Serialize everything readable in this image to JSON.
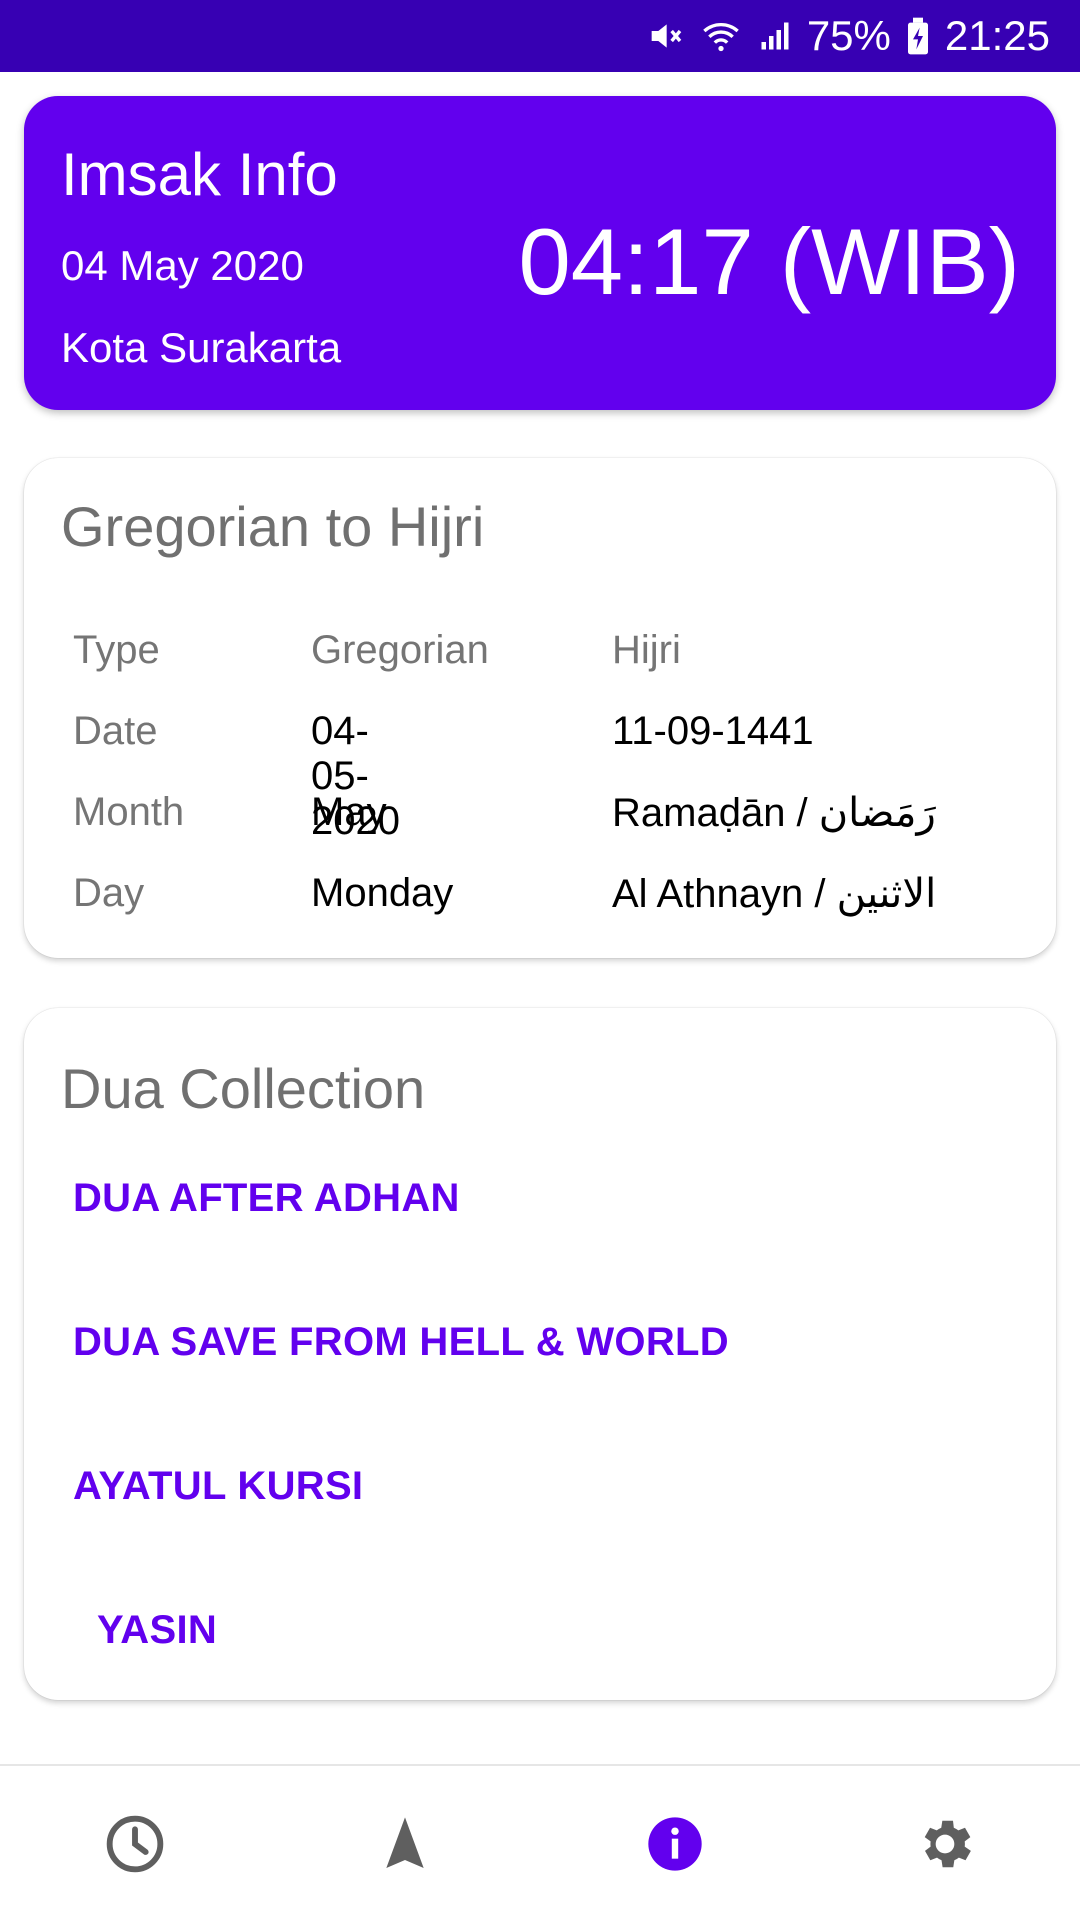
{
  "status_bar": {
    "battery": "75%",
    "time": "21:25",
    "icons": [
      "mute-icon",
      "wifi-icon",
      "signal-icon",
      "battery-charging-icon"
    ]
  },
  "imsak": {
    "title": "Imsak Info",
    "date": "04 May 2020",
    "city": "Kota Surakarta",
    "time": "04:17 (WIB)"
  },
  "hijri_card": {
    "title": "Gregorian to Hijri",
    "header": [
      "Type",
      "Gregorian",
      "Hijri"
    ],
    "rows": [
      {
        "type": "Date",
        "gregorian": "04-05-2020",
        "hijri": "11-09-1441"
      },
      {
        "type": "Month",
        "gregorian": "May",
        "hijri": "Ramaḍān / رَمَضان"
      },
      {
        "type": "Day",
        "gregorian": "Monday",
        "hijri": "Al Athnayn / الاثنين"
      }
    ]
  },
  "dua_card": {
    "title": "Dua Collection",
    "items": [
      "DUA AFTER ADHAN",
      "DUA SAVE FROM HELL & WORLD",
      "AYATUL KURSI",
      "YASIN"
    ]
  },
  "bottom_nav": {
    "items": [
      "clock-icon",
      "navigation-icon",
      "info-icon",
      "settings-icon"
    ],
    "active": "info-icon"
  },
  "colors": {
    "primary": "#6200ee",
    "status_bar": "#3700b3",
    "inactive_icon": "#5f5f5f"
  }
}
